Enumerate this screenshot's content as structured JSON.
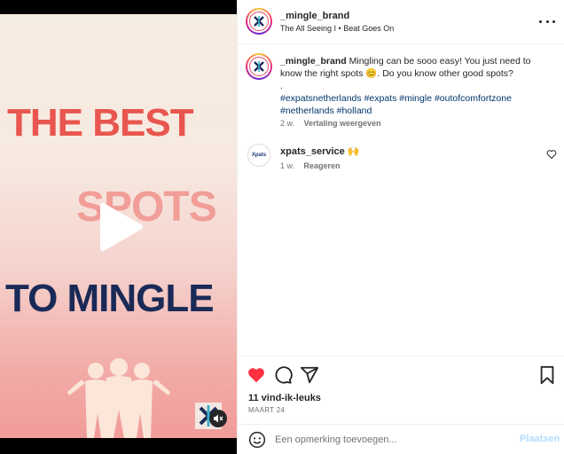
{
  "video": {
    "line1": "THE BEST",
    "line2": "SPOTS",
    "line3": "TO MINGLE"
  },
  "header": {
    "username": "_mingle_brand",
    "audio": "The All Seeing I • Beat Goes On"
  },
  "caption": {
    "username": "_mingle_brand",
    "text": "Mingling can be sooo easy! You just need to know the right spots 😊. Do you know other good spots?",
    "dot": ".",
    "hashtags": "#expatsnetherlands #expats #mingle #outofcomfortzone #netherlands #holland",
    "time": "2 w.",
    "translate": "Vertaling weergeven"
  },
  "comment": {
    "avatar_text": "Xpats",
    "username": "xpats_service 🙌",
    "time": "1 w.",
    "reply": "Reageren"
  },
  "engagement": {
    "likes": "11 vind-ik-leuks",
    "date": "MAART 24"
  },
  "add_comment": {
    "placeholder": "Een opmerking toevoegen...",
    "post_label": "Plaatsen"
  },
  "colors": {
    "like_red": "#ff3040",
    "link_blue": "#00376b",
    "post_disabled": "#b3dbff"
  },
  "icons": [
    "play-icon",
    "mute-icon",
    "more-icon",
    "heart-icon",
    "comment-icon",
    "share-icon",
    "bookmark-icon",
    "emoji-icon"
  ]
}
